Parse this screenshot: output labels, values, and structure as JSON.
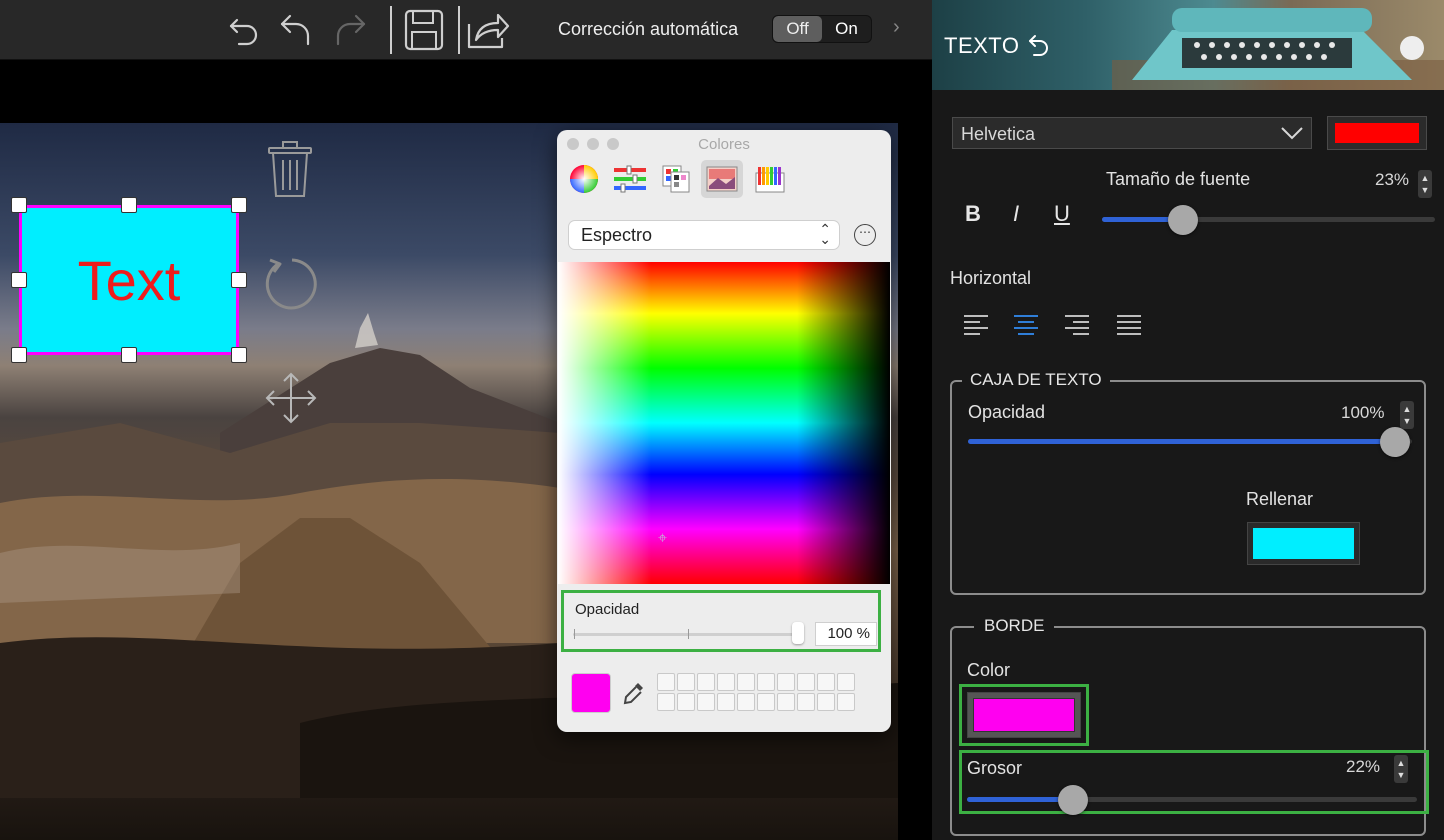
{
  "toolbar": {
    "autocorrect_label": "Corrección automática",
    "toggle_off": "Off",
    "toggle_on": "On",
    "chevron": "›"
  },
  "canvas": {
    "textbox_text": "Text",
    "textbox_fill": "#00eeff",
    "textbox_border": "#ff00ff",
    "text_color": "#ee1c1c"
  },
  "colors_panel": {
    "title": "Colores",
    "mode": "Espectro",
    "opacity_label": "Opacidad",
    "opacity_value": "100 %",
    "current_color": "#ff00f0"
  },
  "text_panel": {
    "title": "TEXTO",
    "font": "Helvetica",
    "font_color": "#ff0000",
    "font_size_label": "Tamaño de fuente",
    "font_size_value": "23%",
    "bold": "B",
    "italic": "I",
    "underline": "U",
    "horizontal_label": "Horizontal",
    "textbox_section": {
      "legend": "CAJA DE TEXTO",
      "opacity_label": "Opacidad",
      "opacity_value": "100%",
      "fill_label": "Rellenar",
      "fill_color": "#00eeff"
    },
    "border_section": {
      "legend": "BORDE",
      "color_label": "Color",
      "color": "#ff00f0",
      "thickness_label": "Grosor",
      "thickness_value": "22%"
    }
  }
}
